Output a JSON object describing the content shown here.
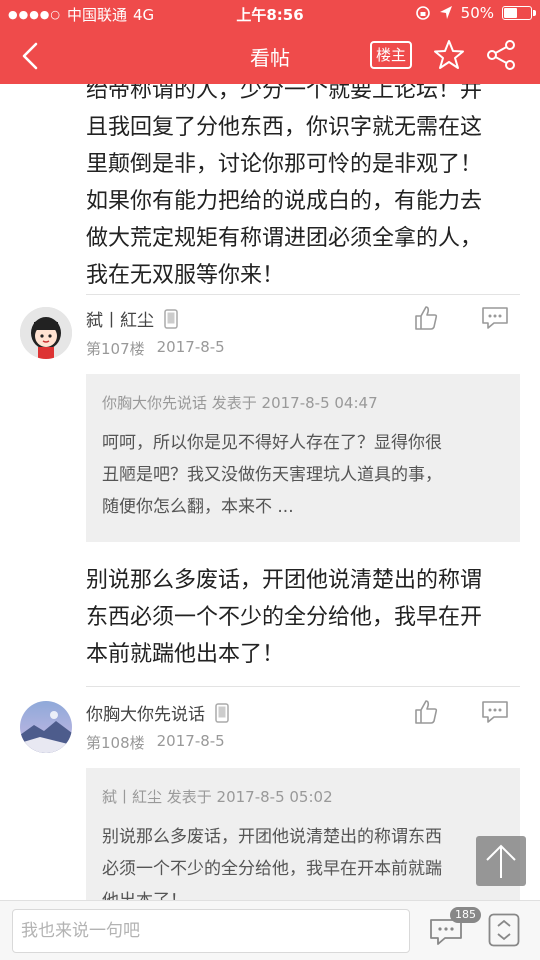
{
  "status_bar": {
    "carrier": "中国联通",
    "network": "4G",
    "time": "上午8:56",
    "battery": "50%",
    "battery_level": 0.5
  },
  "nav": {
    "title": "看帖",
    "owner_label": "楼主"
  },
  "posts": [
    {
      "text_lines": [
        "绐帝称谓的人，少分一个就要上论坛！并",
        "且我回复了分他东西，你识字就无需在这",
        "里颠倒是非，讨论你那可怜的是非观了！",
        "如果你有能力把给的说成白的，有能力去",
        "做大荒定规矩有称谓进团必须全拿的人，",
        "我在无双服等你来！"
      ]
    },
    {
      "author": "弑丨紅尘",
      "floor": "第107楼",
      "date": "2017-8-5",
      "quote": {
        "header": "你胸大你先说话 发表于 2017-8-5 04:47",
        "lines": [
          "呵呵，所以你是见不得好人存在了？显得你很",
          "丑陋是吧？我又没做伤天害理坑人道具的事，",
          "随便你怎么翻，本来不 ..."
        ]
      },
      "text_lines": [
        " 别说那么多废话，开团他说清楚出的称谓",
        "东西必须一个不少的全分给他，我早在开",
        "本前就踹他出本了！"
      ]
    },
    {
      "author": "你胸大你先说话",
      "floor": "第108楼",
      "date": "2017-8-5",
      "quote": {
        "header": "弑丨紅尘 发表于 2017-8-5 05:02",
        "lines": [
          "别说那么多废话，开团他说清楚出的称谓东西",
          "必须一个不少的全分给他，我早在开本前就踹",
          "他出本了！"
        ]
      }
    }
  ],
  "bottom_bar": {
    "input_placeholder": "我也来说一句吧",
    "reply_count": "185"
  },
  "colors": {
    "accent": "#ef4b4b",
    "quote_bg": "#efefef"
  }
}
